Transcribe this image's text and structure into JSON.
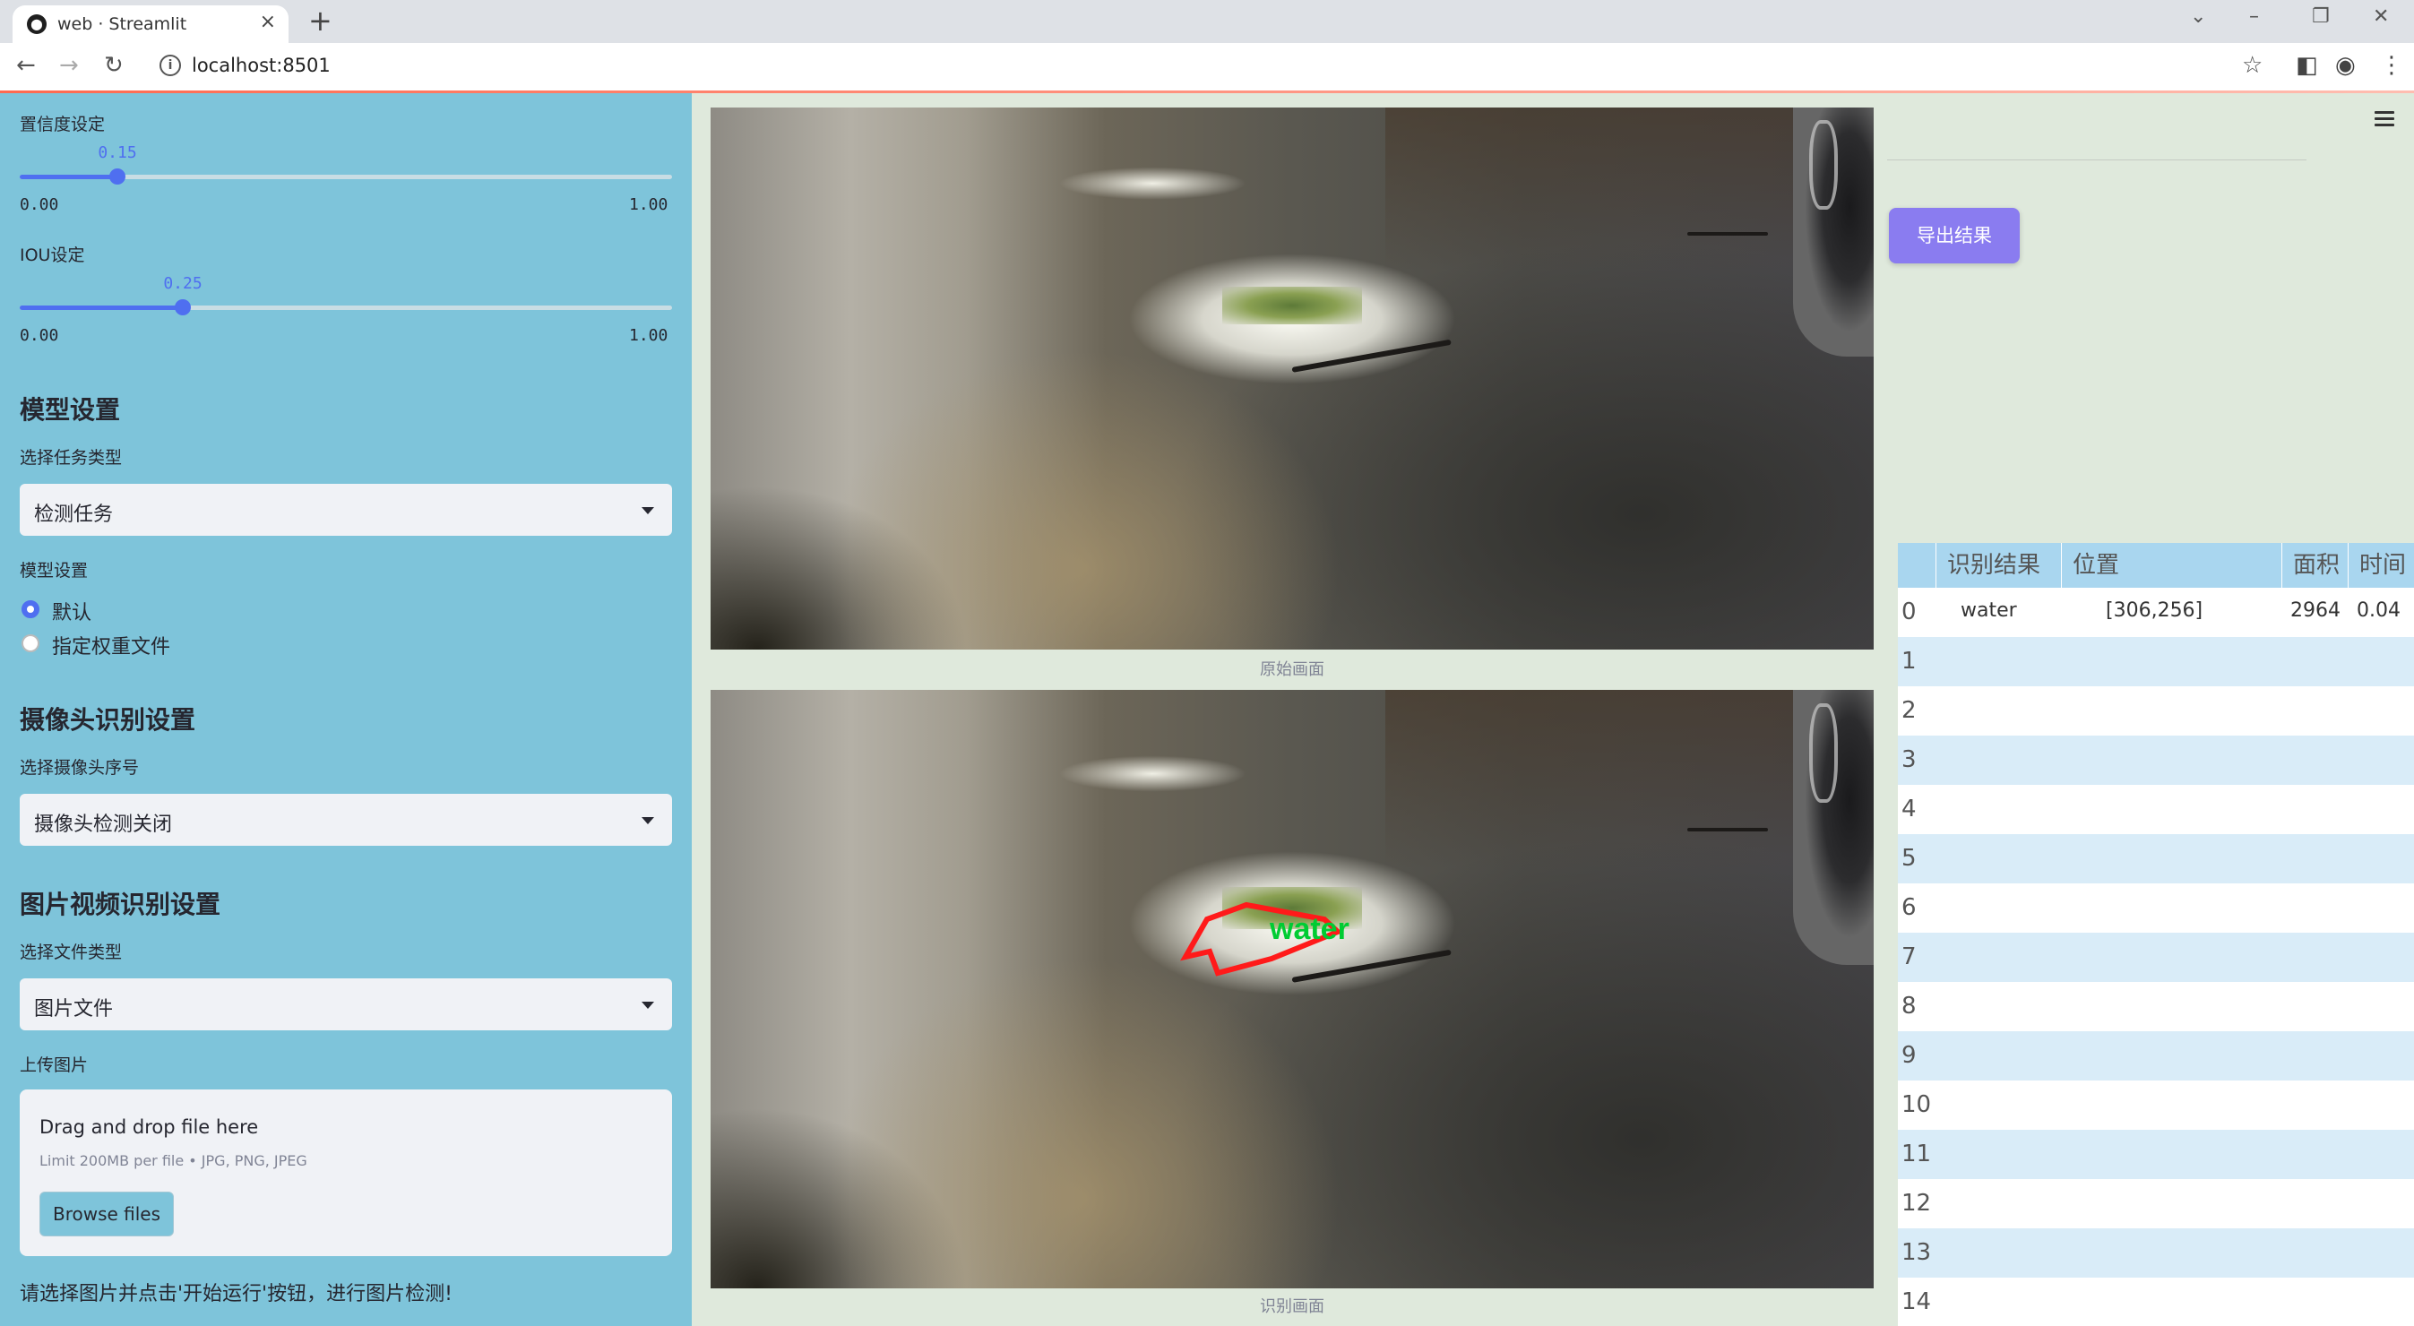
{
  "browser": {
    "tab_title": "web · Streamlit",
    "url": "localhost:8501"
  },
  "sidebar": {
    "confidence": {
      "label": "置信度设定",
      "value": "0.15",
      "value_fraction": 0.15,
      "min": "0.00",
      "max": "1.00"
    },
    "iou": {
      "label": "IOU设定",
      "value": "0.25",
      "value_fraction": 0.25,
      "min": "0.00",
      "max": "1.00"
    },
    "model_heading": "模型设置",
    "task_type_label": "选择任务类型",
    "task_type_value": "检测任务",
    "model_settings_label": "模型设置",
    "model_options": [
      "默认",
      "指定权重文件"
    ],
    "model_selected": "默认",
    "camera_heading": "摄像头识别设置",
    "camera_label": "选择摄像头序号",
    "camera_value": "摄像头检测关闭",
    "media_heading": "图片视频识别设置",
    "file_type_label": "选择文件类型",
    "file_type_value": "图片文件",
    "upload_label": "上传图片",
    "upload_drag": "Drag and drop file here",
    "upload_limit": "Limit 200MB per file • JPG, PNG, JPEG",
    "browse_button": "Browse files",
    "hint": "请选择图片并点击'开始运行'按钮，进行图片检测!"
  },
  "main": {
    "original_caption": "原始画面",
    "result_caption": "识别画面",
    "detection_label": "water",
    "detection_color": "#ff0000",
    "label_color": "#00cc33",
    "export_button": "导出结果"
  },
  "table": {
    "columns": [
      "识别结果",
      "位置",
      "面积",
      "时间"
    ],
    "rows": [
      {
        "index": "0",
        "result": "water",
        "position": "[306,256]",
        "area": "2964",
        "time": "0.04"
      },
      {
        "index": "1"
      },
      {
        "index": "2"
      },
      {
        "index": "3"
      },
      {
        "index": "4"
      },
      {
        "index": "5"
      },
      {
        "index": "6"
      },
      {
        "index": "7"
      },
      {
        "index": "8"
      },
      {
        "index": "9"
      },
      {
        "index": "10"
      },
      {
        "index": "11"
      },
      {
        "index": "12"
      },
      {
        "index": "13"
      },
      {
        "index": "14"
      }
    ]
  },
  "colors": {
    "sidebar_bg": "#7ec4da",
    "main_bg": "#dfe9dc",
    "accent": "#4f6ff0",
    "export_button": "#8a7cf0",
    "table_header": "#a9d6ef",
    "table_stripe": "#d9ecf8"
  }
}
